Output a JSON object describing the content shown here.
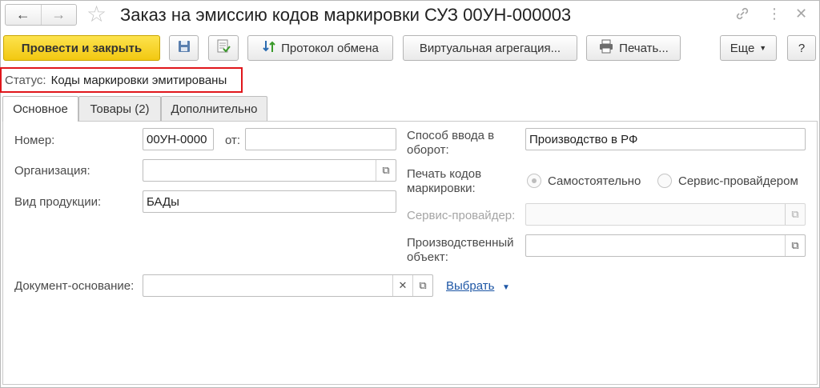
{
  "window": {
    "title": "Заказ на эмиссию кодов маркировки СУЗ 00УН-000003"
  },
  "toolbar": {
    "post_close": "Провести и закрыть",
    "exchange_log": "Протокол обмена",
    "virtual_aggregation": "Виртуальная агрегация...",
    "print": "Печать...",
    "more": "Еще",
    "help": "?"
  },
  "status": {
    "label": "Статус:",
    "value": "Коды маркировки эмитированы"
  },
  "tabs": [
    {
      "label": "Основное",
      "active": true
    },
    {
      "label": "Товары (2)",
      "active": false
    },
    {
      "label": "Дополнительно",
      "active": false
    }
  ],
  "form": {
    "number_label": "Номер:",
    "number_value": "00УН-0000",
    "date_label": "от:",
    "date_value": "",
    "organization_label": "Организация:",
    "organization_value": "",
    "product_type_label": "Вид продукции:",
    "product_type_value": "БАДы",
    "entry_method_label_1": "Способ ввода в",
    "entry_method_label_2": "оборот:",
    "entry_method_value": "Производство в РФ",
    "print_codes_label_1": "Печать кодов",
    "print_codes_label_2": "маркировки:",
    "print_option_self": "Самостоятельно",
    "print_option_provider": "Сервис-провайдером",
    "service_provider_label": "Сервис-провайдер:",
    "service_provider_value": "",
    "production_object_label_1": "Производственный",
    "production_object_label_2": "объект:",
    "production_object_value": "",
    "base_document_label": "Документ-основание:",
    "base_document_value": "",
    "select_link": "Выбрать"
  }
}
